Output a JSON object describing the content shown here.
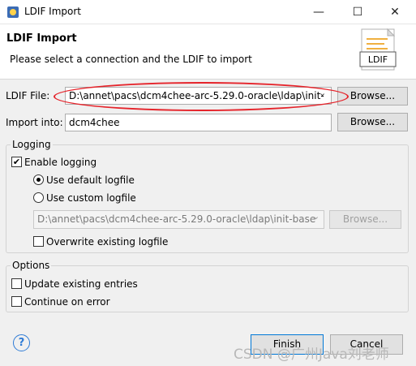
{
  "window": {
    "title": "LDIF Import",
    "minimize": "—",
    "maximize": "☐",
    "close": "✕"
  },
  "banner": {
    "title": "LDIF Import",
    "description": "Please select a connection and the LDIF to import",
    "image_label": "LDIF"
  },
  "form": {
    "ldif_file_label": "LDIF File:",
    "ldif_file_value": "D:\\annet\\pacs\\dcm4chee-arc-5.29.0-oracle\\ldap\\init-",
    "ldif_browse": "Browse...",
    "import_into_label": "Import into:",
    "import_into_value": "dcm4chee",
    "import_browse": "Browse..."
  },
  "logging": {
    "group_title": "Logging",
    "enable_label": "Enable logging",
    "enable_checked": true,
    "default_label": "Use default logfile",
    "custom_label": "Use custom logfile",
    "selected": "default",
    "logfile_value": "D:\\annet\\pacs\\dcm4chee-arc-5.29.0-oracle\\ldap\\init-base",
    "logfile_browse": "Browse...",
    "overwrite_label": "Overwrite existing logfile"
  },
  "options": {
    "group_title": "Options",
    "update_label": "Update existing entries",
    "continue_label": "Continue on error"
  },
  "footer": {
    "help": "?",
    "finish": "Finish",
    "cancel": "Cancel"
  },
  "watermark": "CSDN @广州Java刘老师"
}
